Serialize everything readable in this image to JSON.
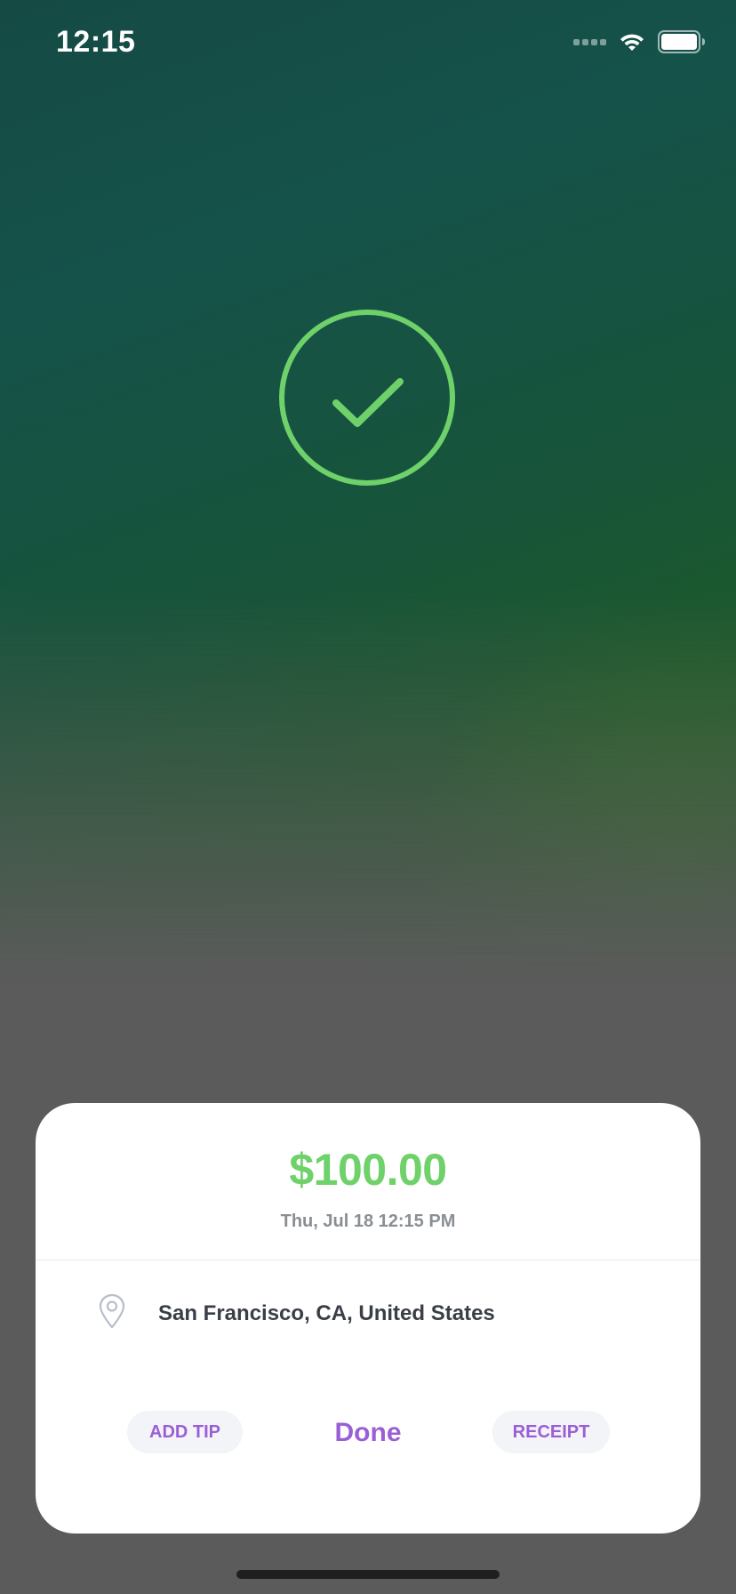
{
  "status_bar": {
    "time": "12:15"
  },
  "success": {
    "icon": "checkmark-circle-icon",
    "color": "#6fd16a"
  },
  "payment": {
    "amount": "$100.00",
    "datetime": "Thu, Jul 18 12:15 PM",
    "location": "San Francisco, CA, United States",
    "location_icon": "map-pin-icon"
  },
  "actions": {
    "add_tip": "ADD TIP",
    "done": "Done",
    "receipt": "RECEIPT"
  },
  "colors": {
    "accent": "#9a5fd6",
    "amount": "#6fd16a",
    "card_bg": "#ffffff",
    "overlay": "#5b5b5b"
  }
}
